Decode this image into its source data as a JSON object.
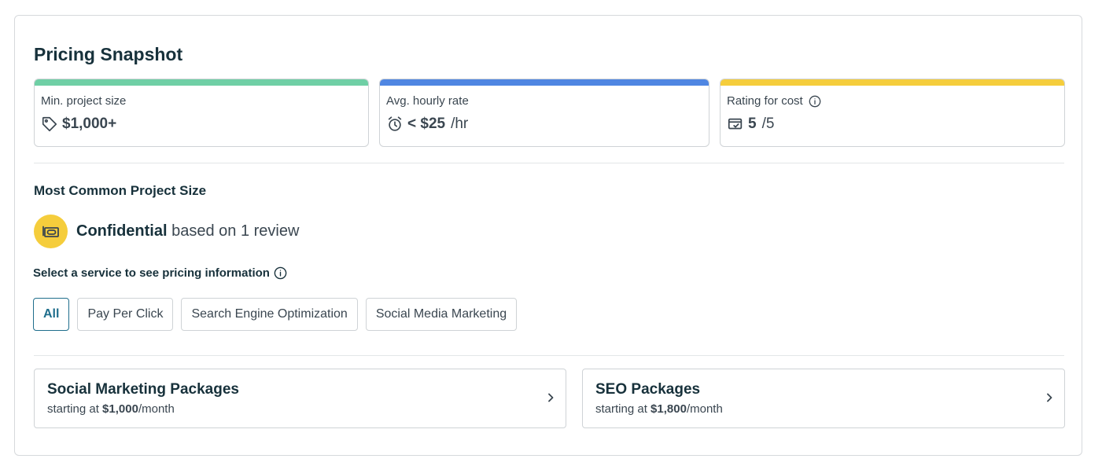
{
  "title": "Pricing Snapshot",
  "stats": [
    {
      "label": "Min. project size",
      "value": "$1,000+",
      "unit": "",
      "icon": "tag-icon",
      "color": "#6fcfa5"
    },
    {
      "label": "Avg. hourly rate",
      "value": "< $25",
      "unit": "/hr",
      "icon": "alarm-clock-icon",
      "color": "#4f86e2"
    },
    {
      "label": "Rating for cost",
      "value": "5",
      "unit": "/5",
      "icon": "wallet-icon",
      "color": "#f5cd3c"
    }
  ],
  "common": {
    "heading": "Most Common Project Size",
    "value": "Confidential",
    "suffix": " based on 1 review",
    "icon": "money-icon"
  },
  "select_label": "Select a service to see pricing information",
  "chips": [
    "All",
    "Pay Per Click",
    "Search Engine Optimization",
    "Social Media Marketing"
  ],
  "active_chip": "All",
  "packages": [
    {
      "name": "Social Marketing Packages",
      "prefix": "starting at ",
      "price": "$1,000",
      "period": "/month"
    },
    {
      "name": "SEO Packages",
      "prefix": "starting at ",
      "price": "$1,800",
      "period": "/month"
    }
  ],
  "colors": {
    "accent": "#1f6e8c",
    "yellow": "#f5cd3c",
    "green": "#6fcfa5",
    "blue": "#4f86e2"
  }
}
